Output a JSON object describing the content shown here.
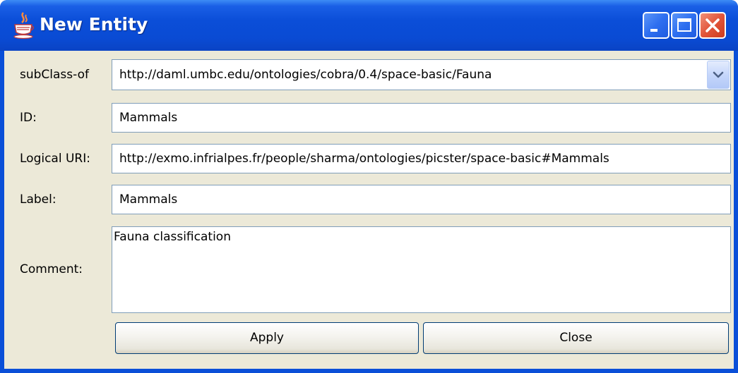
{
  "window": {
    "title": "New Entity",
    "icon": "java-cup-icon",
    "controls": [
      "minimize-icon",
      "maximize-icon",
      "close-icon"
    ]
  },
  "form": {
    "subclass": {
      "label": "subClass-of",
      "value": "http://daml.umbc.edu/ontologies/cobra/0.4/space-basic/Fauna"
    },
    "id": {
      "label": "ID:",
      "value": "Mammals"
    },
    "logical_uri": {
      "label": "Logical URI:",
      "value": "http://exmo.infrialpes.fr/people/sharma/ontologies/picster/space-basic#Mammals"
    },
    "label_field": {
      "label": "Label:",
      "value": "Mammals"
    },
    "comment": {
      "label": "Comment:",
      "value": "Fauna classification"
    }
  },
  "buttons": {
    "apply": "Apply",
    "close": "Close"
  },
  "colors": {
    "titlebar": "#0a4bd4",
    "client": "#ece9d8",
    "field_border": "#7f9db9",
    "close_button": "#e2553a"
  }
}
